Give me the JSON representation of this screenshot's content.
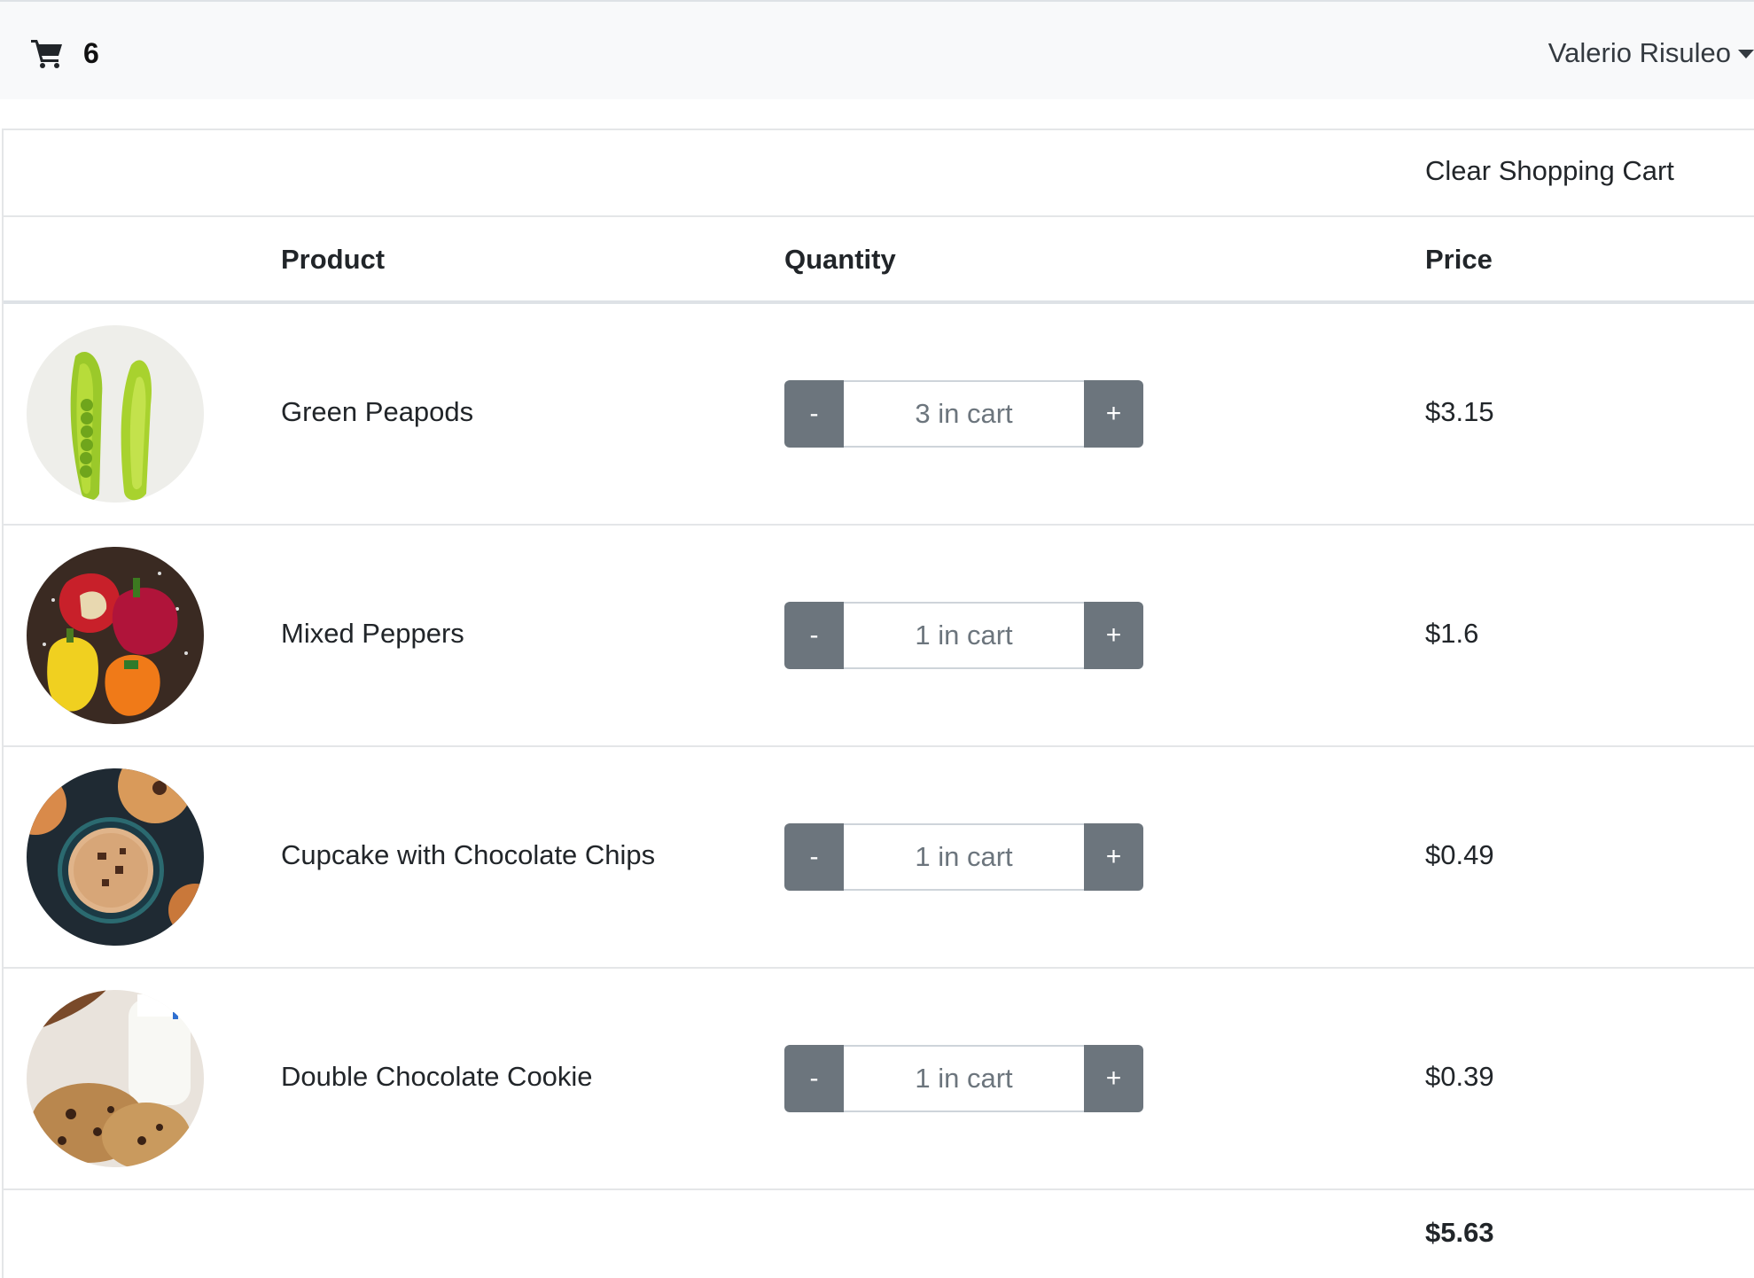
{
  "navbar": {
    "cart_icon": "shopping-cart-icon",
    "cart_count": "6",
    "user_name": "Valerio Risuleo",
    "user_caret_icon": "caret-down-icon"
  },
  "cart": {
    "clear_label": "Clear Shopping Cart",
    "columns": {
      "product": "Product",
      "quantity": "Quantity",
      "price": "Price"
    },
    "items": [
      {
        "name": "Green Peapods",
        "quantity_placeholder": "3 in cart",
        "minus": "-",
        "plus": "+",
        "price": "$3.15",
        "image": "green-peapods-image"
      },
      {
        "name": "Mixed Peppers",
        "quantity_placeholder": "1 in cart",
        "minus": "-",
        "plus": "+",
        "price": "$1.6",
        "image": "mixed-peppers-image"
      },
      {
        "name": "Cupcake with Chocolate Chips",
        "quantity_placeholder": "1 in cart",
        "minus": "-",
        "plus": "+",
        "price": "$0.49",
        "image": "cupcake-image"
      },
      {
        "name": "Double Chocolate Cookie",
        "quantity_placeholder": "1 in cart",
        "minus": "-",
        "plus": "+",
        "price": "$0.39",
        "image": "cookie-image"
      }
    ],
    "total": "$5.63"
  },
  "colors": {
    "navbar_bg": "#f8f9fa",
    "stepper_button": "#6c757d",
    "border": "#e4e6e8"
  }
}
